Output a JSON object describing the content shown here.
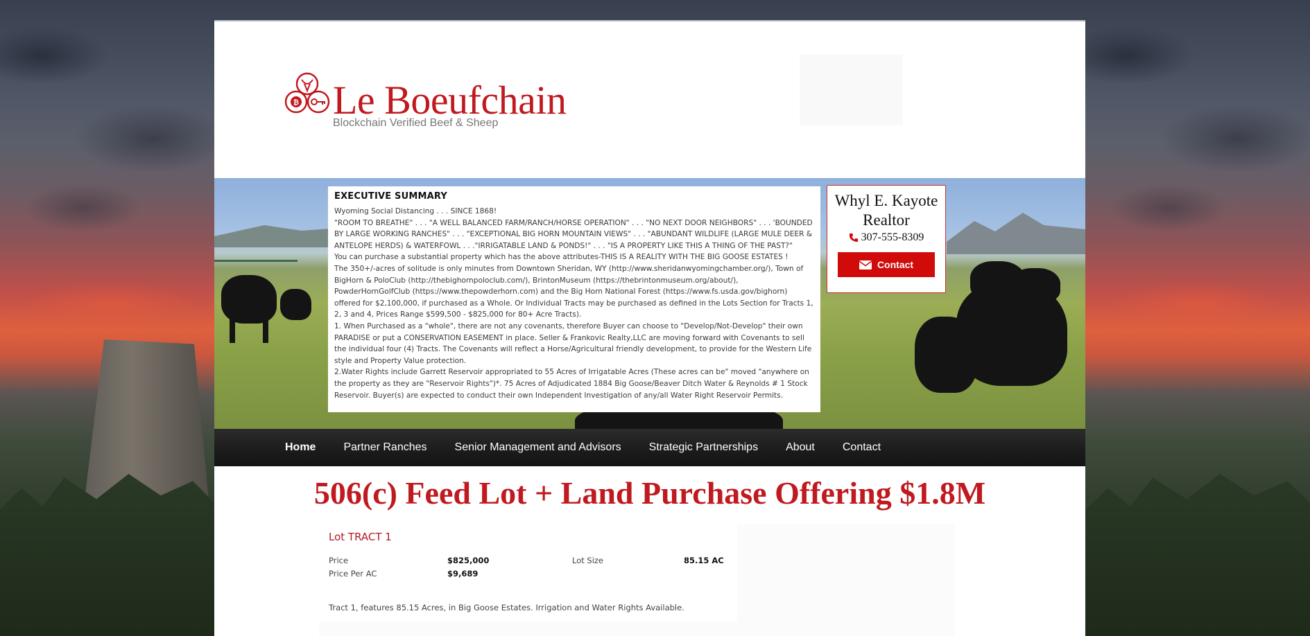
{
  "brand": {
    "title": "Le Boeufchain",
    "subtitle": "Blockchain Verified Beef & Sheep",
    "accent": "#c0191f"
  },
  "summary": {
    "heading": "EXECUTIVE SUMMARY",
    "paragraphs": [
      "Wyoming Social Distancing . . . SINCE 1868!",
      "\"ROOM TO BREATHE\" . . . \"A WELL BALANCED FARM/RANCH/HORSE OPERATION\" . . . \"NO NEXT DOOR NEIGHBORS\" . . . 'BOUNDED BY LARGE WORKING RANCHES\" . . . \"EXCEPTIONAL BIG HORN MOUNTAIN VIEWS\" . . . \"ABUNDANT WILDLIFE (LARGE MULE DEER & ANTELOPE HERDS) & WATERFOWL . . .\"IRRIGATABLE LAND & PONDS!\" . . . \"IS A PROPERTY LIKE THIS A THING OF THE PAST?\"",
      "You can purchase a substantial property which has the above attributes-THIS IS A REALITY WITH THE BIG GOOSE ESTATES !",
      "The 350+/-acres of solitude is only minutes from Downtown Sheridan, WY (http://www.sheridanwyomingchamber.org/), Town of BigHorn & PoloClub (http://thebighornpoloclub.com/), BrintonMuseum (https://thebrintonmuseum.org/about/), PowderHornGolfClub (https://www.thepowderhorn.com) and the Big Horn National Forest (https://www.fs.usda.gov/bighorn) offered for $2,100,000, if purchased as a Whole. Or Individual Tracts may be purchased as defined in the Lots Section for Tracts 1, 2, 3 and 4, Prices Range $599,500 - $825,000 for 80+ Acre Tracts).",
      "1. When Purchased as a \"whole\", there are not any covenants, therefore Buyer can choose to \"Develop/Not-Develop\" their own PARADISE or put a CONSERVATION EASEMENT in place. Seller & Frankovic Realty,LLC are moving forward with Covenants to sell the individual four (4) Tracts. The Covenants will reflect a Horse/Agricultural friendly development, to provide for the Western Life style and Property Value protection.",
      "2.Water Rights include Garrett Reservoir appropriated to 55 Acres of Irrigatable Acres (These acres can be\" moved \"anywhere on the property as they are \"Reservoir Rights\")*. 75 Acres of Adjudicated 1884 Big Goose/Beaver Ditch Water & Reynolds # 1 Stock Reservoir. Buyer(s) are expected to conduct their own Independent Investigation of any/all Water Right Reservoir Permits."
    ]
  },
  "contact_card": {
    "name": "Whyl E. Kayote",
    "role": "Realtor",
    "phone": "307-555-8309",
    "button_label": "Contact",
    "phone_icon": "phone-icon",
    "mail_icon": "envelope-icon"
  },
  "nav": {
    "items": [
      {
        "label": "Home",
        "active": true
      },
      {
        "label": "Partner Ranches"
      },
      {
        "label": "Senior Management and Advisors"
      },
      {
        "label": "Strategic Partnerships"
      },
      {
        "label": "About"
      },
      {
        "label": "Contact"
      }
    ]
  },
  "offering": {
    "title": "506(c) Feed Lot + Land Purchase Offering $1.8M"
  },
  "lot": {
    "title": "Lot TRACT 1",
    "price_label": "Price",
    "price": "$825,000",
    "lot_size_label": "Lot Size",
    "lot_size": "85.15 AC",
    "price_per_ac_label": "Price Per AC",
    "price_per_ac": "$9,689",
    "description": "Tract 1, features 85.15 Acres, in Big Goose Estates. Irrigation and Water Rights Available."
  },
  "colors": {
    "brand_red": "#c0191f",
    "button_red": "#d10a0a",
    "nav_bg": "#1b1b1b"
  }
}
